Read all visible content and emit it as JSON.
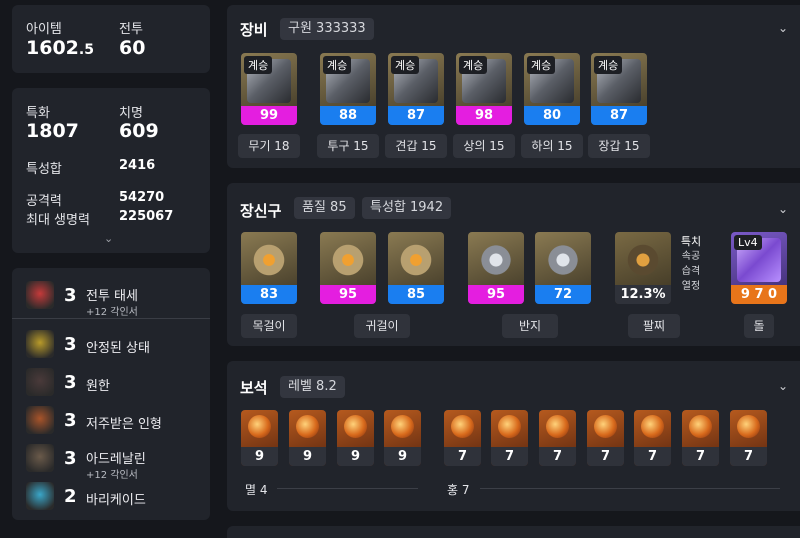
{
  "summary": {
    "item_level_label": "아이템",
    "item_level_main": "1602",
    "item_level_dec": ".5",
    "combat_label": "전투",
    "combat_value": "60"
  },
  "stats": {
    "spec_label": "특화",
    "spec_value": "1807",
    "crit_label": "치명",
    "crit_value": "609",
    "total_label": "특성합",
    "total_value": "2416",
    "atk_label": "공격력",
    "atk_value": "54270",
    "hp_label": "최대 생명력",
    "hp_value": "225067"
  },
  "engravings": [
    {
      "count": "3",
      "name": "전투 태세",
      "sub": "+12 각인서",
      "icon": "shield-engraving-icon",
      "color": "#c43a3a"
    },
    {
      "count": "3",
      "name": "안정된 상태",
      "sub": "",
      "icon": "stable-engraving-icon",
      "color": "#b89a2a"
    },
    {
      "count": "3",
      "name": "원한",
      "sub": "",
      "icon": "grudge-engraving-icon",
      "color": "#4a3a3a"
    },
    {
      "count": "3",
      "name": "저주받은 인형",
      "sub": "",
      "icon": "doll-engraving-icon",
      "color": "#a8542a"
    },
    {
      "count": "3",
      "name": "아드레날린",
      "sub": "+12 각인서",
      "icon": "adrenaline-engraving-icon",
      "color": "#6a5a4a"
    },
    {
      "count": "2",
      "name": "바리케이드",
      "sub": "",
      "icon": "barricade-engraving-icon",
      "color": "#3aa6c8"
    }
  ],
  "equipment": {
    "title": "장비",
    "chip": "구원 333333",
    "items": [
      {
        "tag": "계승",
        "quality": "99",
        "color": "#e41ee0",
        "label": "무기 18"
      },
      {
        "tag": "계승",
        "quality": "88",
        "color": "#1a7ef0",
        "label": "투구 15"
      },
      {
        "tag": "계승",
        "quality": "87",
        "color": "#1a7ef0",
        "label": "견갑 15"
      },
      {
        "tag": "계승",
        "quality": "98",
        "color": "#e41ee0",
        "label": "상의 15"
      },
      {
        "tag": "계승",
        "quality": "80",
        "color": "#1a7ef0",
        "label": "하의 15"
      },
      {
        "tag": "계승",
        "quality": "87",
        "color": "#1a7ef0",
        "label": "장갑 15"
      }
    ]
  },
  "accessories": {
    "title": "장신구",
    "chip1": "품질 85",
    "chip2": "특성합 1942",
    "items": [
      {
        "quality": "83",
        "color": "#1a7ef0"
      },
      {
        "quality": "95",
        "color": "#e41ee0"
      },
      {
        "quality": "85",
        "color": "#1a7ef0"
      },
      {
        "quality": "95",
        "color": "#e41ee0"
      },
      {
        "quality": "72",
        "color": "#1a7ef0"
      }
    ],
    "bracelet_value": "12.3%",
    "bracelet_attrs": [
      "특치",
      "속공",
      "습격",
      "열정"
    ],
    "stone_level": "Lv4",
    "stone_value": "9 7 0",
    "labels": {
      "necklace": "목걸이",
      "earring": "귀걸이",
      "ring": "반지",
      "bracelet": "팔찌",
      "stone": "돌"
    }
  },
  "gems": {
    "title": "보석",
    "chip": "레벨 8.2",
    "left_levels": [
      "9",
      "9",
      "9",
      "9"
    ],
    "right_levels": [
      "7",
      "7",
      "7",
      "7",
      "7",
      "7",
      "7"
    ],
    "left_label": "멸 4",
    "right_label": "홍 7"
  }
}
